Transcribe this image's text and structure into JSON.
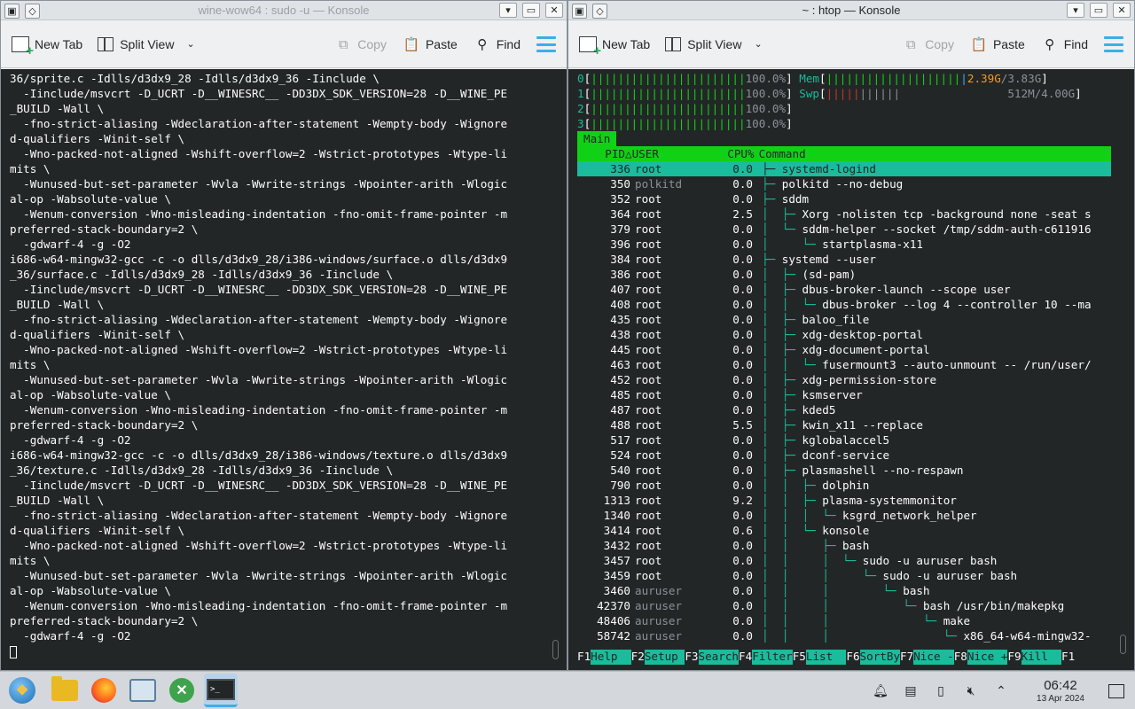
{
  "left_window": {
    "title": "wine-wow64 : sudo -u — Konsole",
    "toolbar": {
      "new_tab": "New Tab",
      "split_view": "Split View",
      "copy": "Copy",
      "paste": "Paste",
      "find": "Find"
    },
    "lines": [
      "36/sprite.c -Idlls/d3dx9_28 -Idlls/d3dx9_36 -Iinclude \\",
      "  -Iinclude/msvcrt -D_UCRT -D__WINESRC__ -DD3DX_SDK_VERSION=28 -D__WINE_PE",
      "_BUILD -Wall \\",
      "  -fno-strict-aliasing -Wdeclaration-after-statement -Wempty-body -Wignore",
      "d-qualifiers -Winit-self \\",
      "  -Wno-packed-not-aligned -Wshift-overflow=2 -Wstrict-prototypes -Wtype-li",
      "mits \\",
      "  -Wunused-but-set-parameter -Wvla -Wwrite-strings -Wpointer-arith -Wlogic",
      "al-op -Wabsolute-value \\",
      "  -Wenum-conversion -Wno-misleading-indentation -fno-omit-frame-pointer -m",
      "preferred-stack-boundary=2 \\",
      "  -gdwarf-4 -g -O2",
      "i686-w64-mingw32-gcc -c -o dlls/d3dx9_28/i386-windows/surface.o dlls/d3dx9",
      "_36/surface.c -Idlls/d3dx9_28 -Idlls/d3dx9_36 -Iinclude \\",
      "  -Iinclude/msvcrt -D_UCRT -D__WINESRC__ -DD3DX_SDK_VERSION=28 -D__WINE_PE",
      "_BUILD -Wall \\",
      "  -fno-strict-aliasing -Wdeclaration-after-statement -Wempty-body -Wignore",
      "d-qualifiers -Winit-self \\",
      "  -Wno-packed-not-aligned -Wshift-overflow=2 -Wstrict-prototypes -Wtype-li",
      "mits \\",
      "  -Wunused-but-set-parameter -Wvla -Wwrite-strings -Wpointer-arith -Wlogic",
      "al-op -Wabsolute-value \\",
      "  -Wenum-conversion -Wno-misleading-indentation -fno-omit-frame-pointer -m",
      "preferred-stack-boundary=2 \\",
      "  -gdwarf-4 -g -O2",
      "i686-w64-mingw32-gcc -c -o dlls/d3dx9_28/i386-windows/texture.o dlls/d3dx9",
      "_36/texture.c -Idlls/d3dx9_28 -Idlls/d3dx9_36 -Iinclude \\",
      "  -Iinclude/msvcrt -D_UCRT -D__WINESRC__ -DD3DX_SDK_VERSION=28 -D__WINE_PE",
      "_BUILD -Wall \\",
      "  -fno-strict-aliasing -Wdeclaration-after-statement -Wempty-body -Wignore",
      "d-qualifiers -Winit-self \\",
      "  -Wno-packed-not-aligned -Wshift-overflow=2 -Wstrict-prototypes -Wtype-li",
      "mits \\",
      "  -Wunused-but-set-parameter -Wvla -Wwrite-strings -Wpointer-arith -Wlogic",
      "al-op -Wabsolute-value \\",
      "  -Wenum-conversion -Wno-misleading-indentation -fno-omit-frame-pointer -m",
      "preferred-stack-boundary=2 \\",
      "  -gdwarf-4 -g -O2"
    ]
  },
  "right_window": {
    "title": "~ : htop — Konsole",
    "toolbar": {
      "new_tab": "New Tab",
      "split_view": "Split View",
      "copy": "Copy",
      "paste": "Paste",
      "find": "Find"
    },
    "cpus": [
      {
        "id": "0",
        "pct": "100.0%"
      },
      {
        "id": "1",
        "pct": "100.0%"
      },
      {
        "id": "2",
        "pct": "100.0%"
      },
      {
        "id": "3",
        "pct": "100.0%"
      }
    ],
    "mem": {
      "label": "Mem",
      "used": "2.39G",
      "total": "/3.83G"
    },
    "swp": {
      "label": "Swp",
      "value": "512M/4.00G"
    },
    "tab": "Main",
    "header": {
      "pid": "PID",
      "sort_mark": "△",
      "user": "USER",
      "cpu": "CPU%",
      "command": "Command"
    },
    "processes": [
      {
        "pid": "336",
        "user": "root",
        "cpu": "0.0",
        "tree": "├─ ",
        "cmd": "systemd-logind",
        "selected": true
      },
      {
        "pid": "350",
        "user": "polkitd",
        "cpu": "0.0",
        "tree": "├─ ",
        "cmd": "polkitd --no-debug"
      },
      {
        "pid": "352",
        "user": "root",
        "cpu": "0.0",
        "tree": "├─ ",
        "cmd": "sddm"
      },
      {
        "pid": "364",
        "user": "root",
        "cpu": "2.5",
        "tree": "│  ├─ ",
        "cmd": "Xorg -nolisten tcp -background none -seat s"
      },
      {
        "pid": "379",
        "user": "root",
        "cpu": "0.0",
        "tree": "│  └─ ",
        "cmd": "sddm-helper --socket /tmp/sddm-auth-c611916"
      },
      {
        "pid": "396",
        "user": "root",
        "cpu": "0.0",
        "tree": "│     └─ ",
        "cmd": "startplasma-x11"
      },
      {
        "pid": "384",
        "user": "root",
        "cpu": "0.0",
        "tree": "├─ ",
        "cmd": "systemd --user"
      },
      {
        "pid": "386",
        "user": "root",
        "cpu": "0.0",
        "tree": "│  ├─ ",
        "cmd": "(sd-pam)"
      },
      {
        "pid": "407",
        "user": "root",
        "cpu": "0.0",
        "tree": "│  ├─ ",
        "cmd": "dbus-broker-launch --scope user"
      },
      {
        "pid": "408",
        "user": "root",
        "cpu": "0.0",
        "tree": "│  │  └─ ",
        "cmd": "dbus-broker --log 4 --controller 10 --ma"
      },
      {
        "pid": "435",
        "user": "root",
        "cpu": "0.0",
        "tree": "│  ├─ ",
        "cmd": "baloo_file"
      },
      {
        "pid": "438",
        "user": "root",
        "cpu": "0.0",
        "tree": "│  ├─ ",
        "cmd": "xdg-desktop-portal"
      },
      {
        "pid": "445",
        "user": "root",
        "cpu": "0.0",
        "tree": "│  ├─ ",
        "cmd": "xdg-document-portal"
      },
      {
        "pid": "463",
        "user": "root",
        "cpu": "0.0",
        "tree": "│  │  └─ ",
        "cmd": "fusermount3 --auto-unmount -- /run/user/"
      },
      {
        "pid": "452",
        "user": "root",
        "cpu": "0.0",
        "tree": "│  ├─ ",
        "cmd": "xdg-permission-store"
      },
      {
        "pid": "485",
        "user": "root",
        "cpu": "0.0",
        "tree": "│  ├─ ",
        "cmd": "ksmserver"
      },
      {
        "pid": "487",
        "user": "root",
        "cpu": "0.0",
        "tree": "│  ├─ ",
        "cmd": "kded5"
      },
      {
        "pid": "488",
        "user": "root",
        "cpu": "5.5",
        "tree": "│  ├─ ",
        "cmd": "kwin_x11 --replace"
      },
      {
        "pid": "517",
        "user": "root",
        "cpu": "0.0",
        "tree": "│  ├─ ",
        "cmd": "kglobalaccel5"
      },
      {
        "pid": "524",
        "user": "root",
        "cpu": "0.0",
        "tree": "│  ├─ ",
        "cmd": "dconf-service"
      },
      {
        "pid": "540",
        "user": "root",
        "cpu": "0.0",
        "tree": "│  ├─ ",
        "cmd": "plasmashell --no-respawn"
      },
      {
        "pid": "790",
        "user": "root",
        "cpu": "0.0",
        "tree": "│  │  ├─ ",
        "cmd": "dolphin"
      },
      {
        "pid": "1313",
        "user": "root",
        "cpu": "9.2",
        "tree": "│  │  ├─ ",
        "cmd": "plasma-systemmonitor"
      },
      {
        "pid": "1340",
        "user": "root",
        "cpu": "0.0",
        "tree": "│  │  │  └─ ",
        "cmd": "ksgrd_network_helper"
      },
      {
        "pid": "3414",
        "user": "root",
        "cpu": "0.6",
        "tree": "│  │  └─ ",
        "cmd": "konsole"
      },
      {
        "pid": "3432",
        "user": "root",
        "cpu": "0.0",
        "tree": "│  │     ├─ ",
        "cmd": "bash"
      },
      {
        "pid": "3457",
        "user": "root",
        "cpu": "0.0",
        "tree": "│  │     │  └─ ",
        "cmd": "sudo -u auruser bash"
      },
      {
        "pid": "3459",
        "user": "root",
        "cpu": "0.0",
        "tree": "│  │     │     └─ ",
        "cmd": "sudo -u auruser bash"
      },
      {
        "pid": "3460",
        "user": "auruser",
        "cpu": "0.0",
        "tree": "│  │     │        └─ ",
        "cmd": "bash"
      },
      {
        "pid": "42370",
        "user": "auruser",
        "cpu": "0.0",
        "tree": "│  │     │           └─ ",
        "cmd": "bash /usr/bin/makepkg"
      },
      {
        "pid": "48406",
        "user": "auruser",
        "cpu": "0.0",
        "tree": "│  │     │              └─ ",
        "cmd": "make"
      },
      {
        "pid": "58742",
        "user": "auruser",
        "cpu": "0.0",
        "tree": "│  │     │                 └─ ",
        "cmd": "x86_64-w64-mingw32-"
      }
    ],
    "fkeys": [
      {
        "k": "F1",
        "l": "Help  "
      },
      {
        "k": "F2",
        "l": "Setup "
      },
      {
        "k": "F3",
        "l": "Search"
      },
      {
        "k": "F4",
        "l": "Filter"
      },
      {
        "k": "F5",
        "l": "List  "
      },
      {
        "k": "F6",
        "l": "SortBy"
      },
      {
        "k": "F7",
        "l": "Nice -"
      },
      {
        "k": "F8",
        "l": "Nice +"
      },
      {
        "k": "F9",
        "l": "Kill  "
      },
      {
        "k": "F1",
        "l": ""
      }
    ]
  },
  "taskbar": {
    "time": "06:42",
    "date": "13 Apr 2024",
    "konsole_icon_text": ">_"
  },
  "colors": {
    "accent": "#3daee9",
    "htop_green": "#11d116",
    "htop_cyan": "#1abc9c",
    "terminal_bg": "#232627"
  }
}
